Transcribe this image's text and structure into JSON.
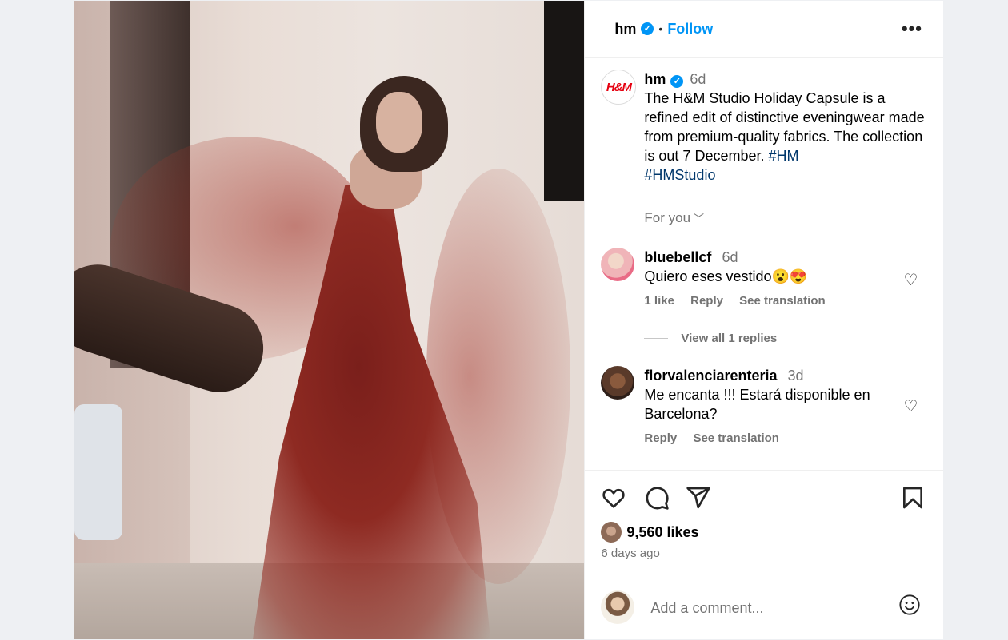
{
  "post": {
    "username": "hm",
    "follow_label": "Follow",
    "more_label": "•••",
    "verified_mark": "✓",
    "dot": "•"
  },
  "caption": {
    "username": "hm",
    "time": "6d",
    "text": "The H&M Studio Holiday Capsule is a refined edit of distinctive eveningwear made from premium-quality fabrics. The collection is out 7 December. ",
    "hashtags": [
      "#HM",
      "#HMStudio"
    ],
    "logo_text": "H&M",
    "for_you_label": "For you"
  },
  "comments": [
    {
      "username": "bluebellcf",
      "time": "6d",
      "text": "Quiero eses vestido😮😍",
      "likes_label": "1 like",
      "reply_label": "Reply",
      "translate_label": "See translation",
      "view_replies_label": "View all 1 replies"
    },
    {
      "username": "florvalenciarenteria",
      "time": "3d",
      "text": "Me encanta !!! Estará disponible en Barcelona?",
      "reply_label": "Reply",
      "translate_label": "See translation"
    }
  ],
  "actions": {
    "likes_count": "9,560 likes",
    "posted_ago": "6 days ago",
    "comment_placeholder": "Add a comment..."
  },
  "icons": [
    "heart-icon",
    "comment-icon",
    "share-icon",
    "bookmark-icon",
    "emoji-icon",
    "verified-icon",
    "more-icon",
    "chevron-down-icon"
  ],
  "colors": {
    "accent": "#0095f6",
    "hashtag": "#00376b",
    "brand_red": "#e50010",
    "muted": "#737373"
  }
}
